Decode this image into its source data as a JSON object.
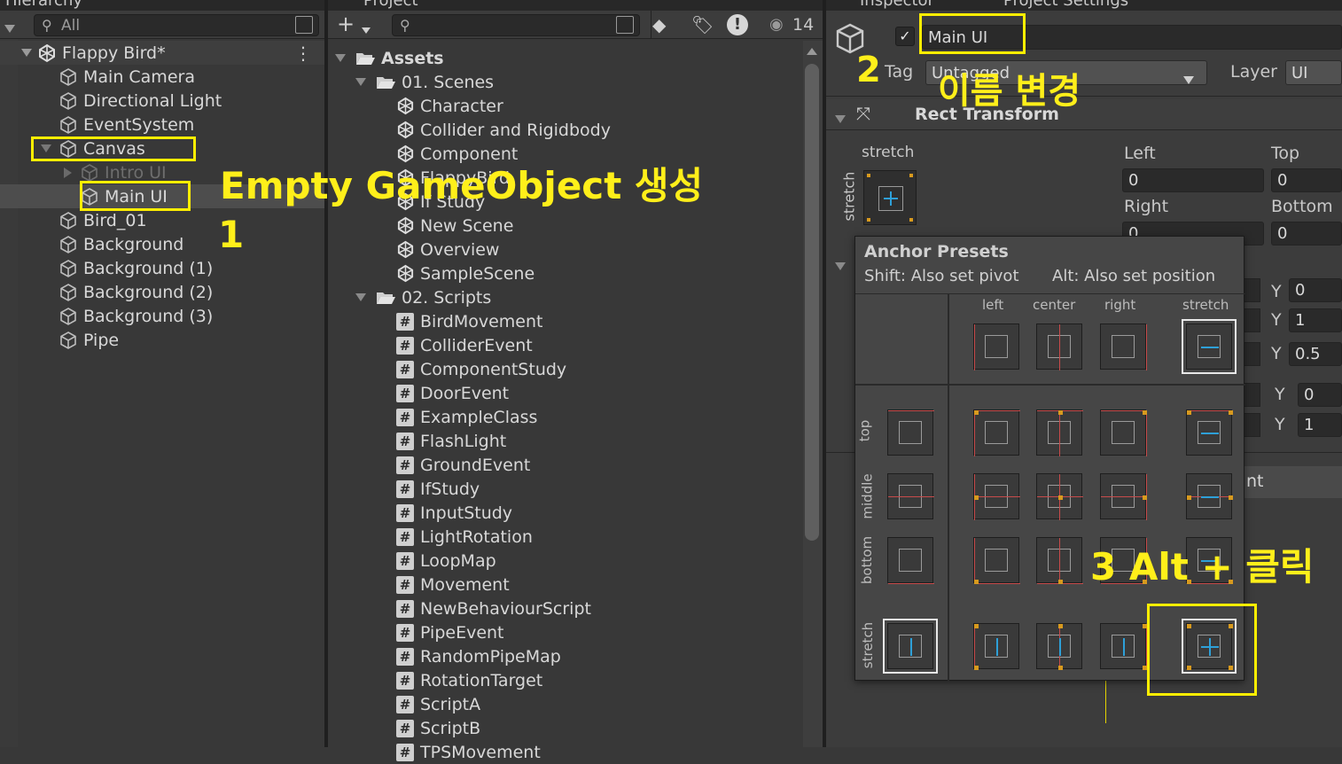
{
  "hierarchy": {
    "tab_title": "Hierarchy",
    "search_placeholder": "All",
    "scene_name": "Flappy Bird*",
    "items": [
      {
        "label": "Main Camera"
      },
      {
        "label": "Directional Light"
      },
      {
        "label": "EventSystem"
      },
      {
        "label": "Canvas"
      },
      {
        "label": "Intro UI"
      },
      {
        "label": "Main UI"
      },
      {
        "label": "Bird_01"
      },
      {
        "label": "Background"
      },
      {
        "label": "Background (1)"
      },
      {
        "label": "Background (2)"
      },
      {
        "label": "Background (3)"
      },
      {
        "label": "Pipe"
      }
    ]
  },
  "project": {
    "tab_title": "Project",
    "hidden_count": "14",
    "assets_label": "Assets",
    "scenes_folder": "01. Scenes",
    "scenes": [
      "Character",
      "Collider and Rigidbody",
      "Component",
      "FlappyBird",
      "If Study",
      "New Scene",
      "Overview",
      "SampleScene"
    ],
    "scripts_folder": "02. Scripts",
    "scripts": [
      "BirdMovement",
      "ColliderEvent",
      "ComponentStudy",
      "DoorEvent",
      "ExampleClass",
      "FlashLight",
      "GroundEvent",
      "IfStudy",
      "InputStudy",
      "LightRotation",
      "LoopMap",
      "Movement",
      "NewBehaviourScript",
      "PipeEvent",
      "RandomPipeMap",
      "RotationTarget",
      "ScriptA",
      "ScriptB",
      "TPSMovement"
    ]
  },
  "inspector": {
    "tab_title": "Inspector",
    "tab2_title": "Project Settings",
    "object_name": "Main UI",
    "tag_label": "Tag",
    "tag_value": "Untagged",
    "layer_label": "Layer",
    "layer_value": "UI",
    "component_title": "Rect Transform",
    "anchor_label": "stretch",
    "anchor_side_label": "stretch",
    "left_label": "Left",
    "left_value": "0",
    "top_label": "Top",
    "top_value": "0",
    "right_label": "Right",
    "right_value": "0",
    "bottom_label": "Bottom",
    "bottom_value": "0",
    "y_rows": [
      {
        "label": "Y",
        "value": "0"
      },
      {
        "label": "Y",
        "value": "1"
      },
      {
        "label": "Y",
        "value": "0.5"
      },
      {
        "label": "Y",
        "value": "0"
      },
      {
        "label": "Y",
        "value": "1"
      }
    ],
    "partial_component": "nt"
  },
  "anchor_presets": {
    "title": "Anchor Presets",
    "hint_shift": "Shift: Also set pivot",
    "hint_alt": "Alt: Also set position",
    "col_labels": [
      "left",
      "center",
      "right",
      "stretch"
    ],
    "row_labels": [
      "top",
      "middle",
      "bottom",
      "stretch"
    ]
  },
  "annotations": {
    "step1_text": "Empty GameObject 생성",
    "step1_num": "1",
    "step2_num": "2",
    "step2_text": "이름 변경",
    "step3_text": "3 Alt + 클릭",
    "color": "#ffee00"
  }
}
